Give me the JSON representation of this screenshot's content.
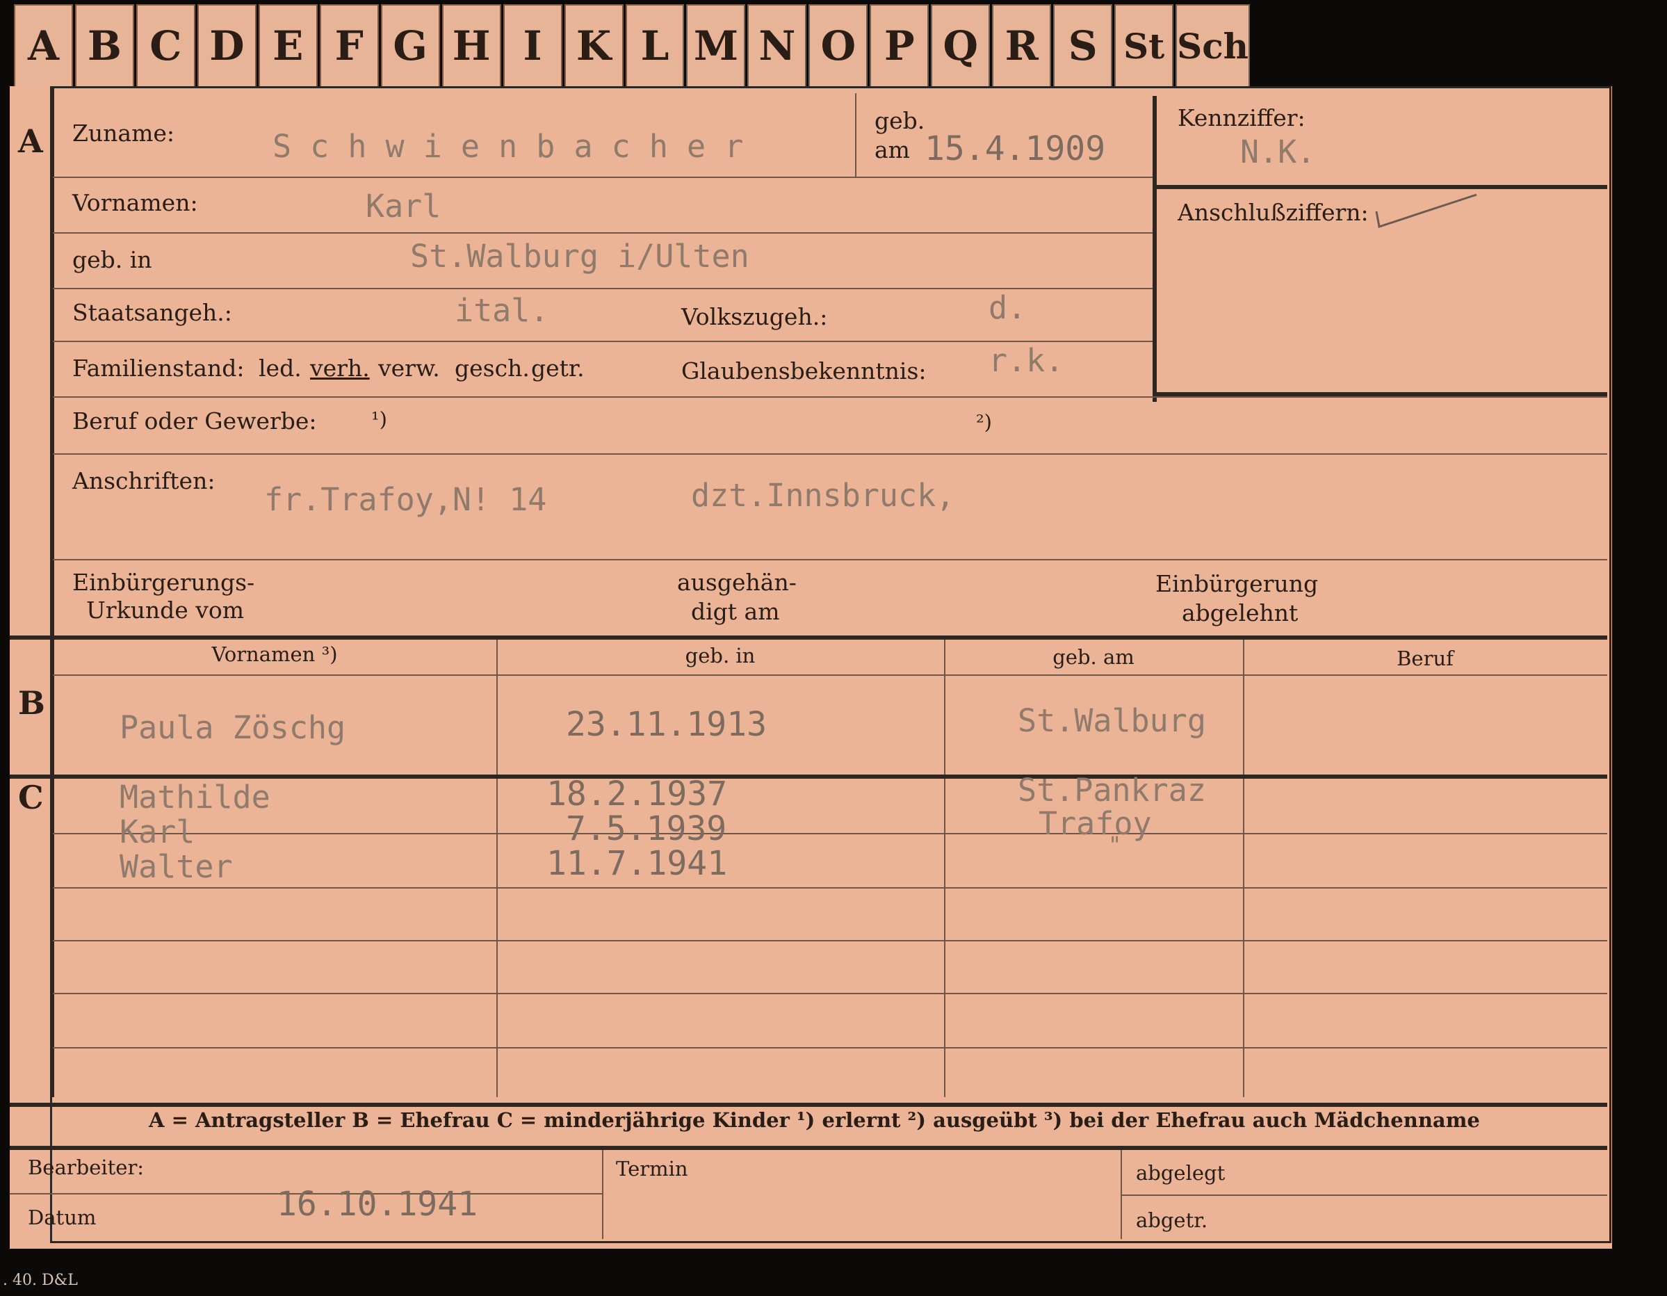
{
  "index_tabs": [
    "A",
    "B",
    "C",
    "D",
    "E",
    "F",
    "G",
    "H",
    "I",
    "K",
    "L",
    "M",
    "N",
    "O",
    "P",
    "Q",
    "R",
    "S",
    "St",
    "Sch"
  ],
  "section_a": {
    "marker": "A",
    "surname_label": "Zuname:",
    "surname_value": "S c h w i e n b a c h e r",
    "birth_label_1": "geb.",
    "birth_label_2": "am",
    "birth_value": "15.4.1909",
    "code_label": "Kennziffer:",
    "code_value": "N.K.",
    "connection_label": "Anschlußziffern:",
    "firstname_label": "Vornamen:",
    "firstname_value": "Karl",
    "birthplace_label": "geb. in",
    "birthplace_value": "St.Walburg i/Ulten",
    "citizenship_label": "Staatsangeh.:",
    "citizenship_value": "ital.",
    "ethnicity_label": "Volkszugeh.:",
    "ethnicity_value": "d.",
    "marital_label": "Familienstand:",
    "marital_options": [
      "led.",
      "verh.",
      "verw.",
      "gesch.",
      "getr."
    ],
    "religion_label": "Glaubensbekenntnis:",
    "religion_value": "r.k.",
    "profession_label": "Beruf oder Gewerbe:",
    "profession_note1": "¹)",
    "profession_note2": "²)",
    "address_label": "Anschriften:",
    "address_value_1": "fr.Trafoy,N! 14",
    "address_value_2": "dzt.Innsbruck,",
    "naturalization_label_1": "Einbürgerungs-",
    "naturalization_label_2": "Urkunde vom",
    "handed_label_1": "ausgehän-",
    "handed_label_2": "digt am",
    "rejected_label_1": "Einbürgerung",
    "rejected_label_2": "abgelehnt"
  },
  "section_b": {
    "marker": "B",
    "headers": [
      "Vornamen ³)",
      "geb. in",
      "geb. am",
      "Beruf"
    ],
    "row": [
      "Paula Zöschg",
      "23.11.1913",
      "St.Walburg",
      ""
    ]
  },
  "section_c": {
    "marker": "C",
    "rows": [
      [
        "Mathilde",
        "18.2.1937",
        "St.Pankraz",
        ""
      ],
      [
        "Karl",
        "7.5.1939",
        "Trafoy",
        ""
      ],
      [
        "Walter",
        "11.7.1941",
        "\"",
        ""
      ]
    ]
  },
  "legend": "A = Antragsteller   B = Ehefrau   C = minderjährige Kinder   ¹) erlernt   ²) ausgeübt   ³) bei der Ehefrau auch Mädchenname",
  "footer": {
    "clerk_label": "Bearbeiter:",
    "date_label": "Datum",
    "date_value": "16.10.1941",
    "deadline_label": "Termin",
    "filed_label": "abgelegt",
    "transferred_label": "abgetr."
  },
  "printer_mark": ". 40. D&L",
  "colors": {
    "card": "#ebb497",
    "ink": "#2a1d15",
    "typed": "#8f7a6c",
    "background": "#0c0a09"
  }
}
